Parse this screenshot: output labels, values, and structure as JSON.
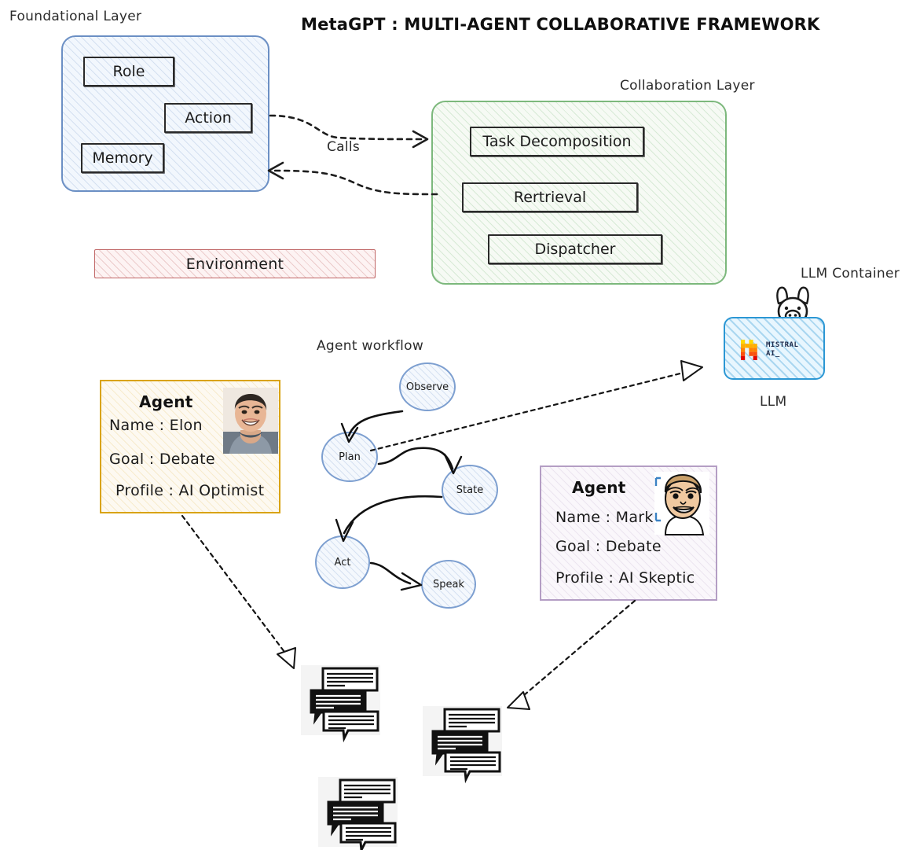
{
  "title": "MetaGPT  : MULTI-AGENT COLLABORATIVE FRAMEWORK",
  "layers": {
    "foundational": {
      "label": "Foundational Layer",
      "boxes": [
        {
          "name": "role",
          "label": "Role"
        },
        {
          "name": "action",
          "label": "Action"
        },
        {
          "name": "memory",
          "label": "Memory"
        }
      ],
      "border_color": "#6b8fc4"
    },
    "collaboration": {
      "label": "Collaboration Layer",
      "boxes": [
        {
          "name": "task-decomposition",
          "label": "Task Decomposition"
        },
        {
          "name": "retrieval",
          "label": "Rertrieval"
        },
        {
          "name": "dispatcher",
          "label": "Dispatcher"
        }
      ],
      "border_color": "#7cb87c"
    },
    "environment": {
      "label": "Environment",
      "border_color": "#c06565"
    }
  },
  "connectors": {
    "calls_label": "Calls"
  },
  "workflow": {
    "label": "Agent workflow",
    "nodes": [
      {
        "name": "observe",
        "label": "Observe"
      },
      {
        "name": "plan",
        "label": "Plan"
      },
      {
        "name": "state",
        "label": "State"
      },
      {
        "name": "act",
        "label": "Act"
      },
      {
        "name": "speak",
        "label": "Speak"
      }
    ]
  },
  "agents": [
    {
      "name": "elon",
      "title": "Agent",
      "fields": [
        {
          "key": "Name",
          "value": "Elon",
          "text": "Name : Elon"
        },
        {
          "key": "Goal",
          "value": "Debate",
          "text": "Goal : Debate"
        },
        {
          "key": "Profile",
          "value": "AI Optimist",
          "text": "Profile : AI Optimist"
        }
      ],
      "accent": "#d9a310"
    },
    {
      "name": "mark",
      "title": "Agent",
      "fields": [
        {
          "key": "Name",
          "value": "Mark",
          "text": "Name : Mark"
        },
        {
          "key": "Goal",
          "value": "Debate",
          "text": "Goal : Debate"
        },
        {
          "key": "Profile",
          "value": "AI Skeptic",
          "text": "Profile : AI Skeptic"
        }
      ],
      "accent": "#b49ec4"
    }
  ],
  "llm": {
    "container_label": "LLM Container",
    "bottom_label": "LLM",
    "provider_line1": "MISTRAL",
    "provider_line2": "AI_",
    "accent": "#2b97d4"
  }
}
